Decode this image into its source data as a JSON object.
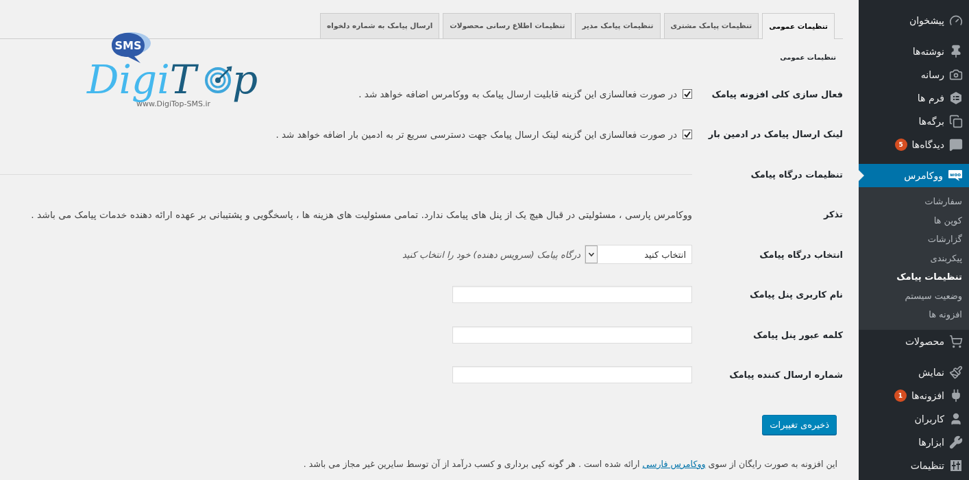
{
  "sidebar": {
    "groups": [
      [
        {
          "label": "پیشخوان",
          "selected": false
        }
      ],
      [
        {
          "label": "نوشته‌ها",
          "selected": false
        },
        {
          "label": "رسانه",
          "selected": false
        },
        {
          "label": "فرم ها",
          "selected": false
        },
        {
          "label": "برگه‌ها",
          "selected": false
        },
        {
          "label": "دیدگاه‌ها",
          "selected": false,
          "badge": "5"
        }
      ],
      [
        {
          "label": "ووکامرس",
          "selected": true,
          "icon_text": "woo",
          "submenu": [
            {
              "label": "سفارشات",
              "selected": false
            },
            {
              "label": "کوپن ها",
              "selected": false
            },
            {
              "label": "گزارشات",
              "selected": false
            },
            {
              "label": "پیکربندی",
              "selected": false
            },
            {
              "label": "تنظیمات پیامک",
              "selected": true
            },
            {
              "label": "وضعیت سیستم",
              "selected": false
            },
            {
              "label": "افزونه ها",
              "selected": false
            }
          ]
        },
        {
          "label": "محصولات",
          "selected": false
        }
      ],
      [
        {
          "label": "نمایش",
          "selected": false
        },
        {
          "label": "افزونه‌ها",
          "selected": false,
          "badge": "1"
        },
        {
          "label": "کاربران",
          "selected": false
        },
        {
          "label": "ابزارها",
          "selected": false
        },
        {
          "label": "تنظیمات",
          "selected": false
        }
      ]
    ]
  },
  "tabs": [
    {
      "label": "تنظیمات عمومی",
      "selected": true
    },
    {
      "label": "تنظیمات پیامک مشتری",
      "selected": false
    },
    {
      "label": "تنظیمات پیامک مدیر",
      "selected": false
    },
    {
      "label": "تنظیمات اطلاع رسانی محصولات",
      "selected": false
    },
    {
      "label": "ارسال پیامک به شماره دلخواه",
      "selected": false
    }
  ],
  "section_title": "تنظیمات عمومی",
  "logo": {
    "bubble": "SMS",
    "wordmark_light": "Digi",
    "wordmark_dark_start": "T",
    "wordmark_dark_end": "p",
    "url": "www.DigiTop-SMS.ir"
  },
  "settings": [
    {
      "kind": "checkbox",
      "label": "فعال سازی کلی افزونه پیامک",
      "checked": true,
      "description": "در صورت فعالسازی این گزینه قابلیت ارسال پیامک به ووکامرس اضافه خواهد شد ."
    },
    {
      "kind": "checkbox",
      "label": "لینک ارسال پیامک در ادمین بار",
      "checked": true,
      "description": "در صورت فعالسازی این گزینه لینک ارسال پیامک جهت دسترسی سریع تر به ادمین بار اضافه خواهد شد ."
    },
    {
      "kind": "heading",
      "label": "تنظیمات درگاه پیامک"
    },
    {
      "kind": "note",
      "label": "تذکر",
      "text": "ووکامرس پارسی ، مسئولیتی در قبال هیچ یک از پنل های پیامک ندارد. تمامی مسئولیت های هزینه ها ، پاسخگویی و پشتیبانی بر عهده ارائه دهنده خدمات پیامک می باشد ."
    },
    {
      "kind": "select",
      "label": "انتخاب درگاه پیامک",
      "value": "انتخاب کنید",
      "description": "درگاه پیامک (سرویس دهنده) خود را انتخاب کنید"
    },
    {
      "kind": "input",
      "label": "نام کاربری پنل پیامک"
    },
    {
      "kind": "input",
      "label": "کلمه عبور پنل پیامک"
    },
    {
      "kind": "input",
      "label": "شماره ارسال کننده پیامک"
    }
  ],
  "save_button": "ذخیره‌ی تغییرات",
  "footer": {
    "before": "این افزونه به صورت رایگان از سوی",
    "link": "ووکامرس فارسی",
    "after": "ارائه شده است . هر گونه کپی برداری و کسب درآمد از آن توسط سایرین غیر مجاز می باشد ."
  }
}
